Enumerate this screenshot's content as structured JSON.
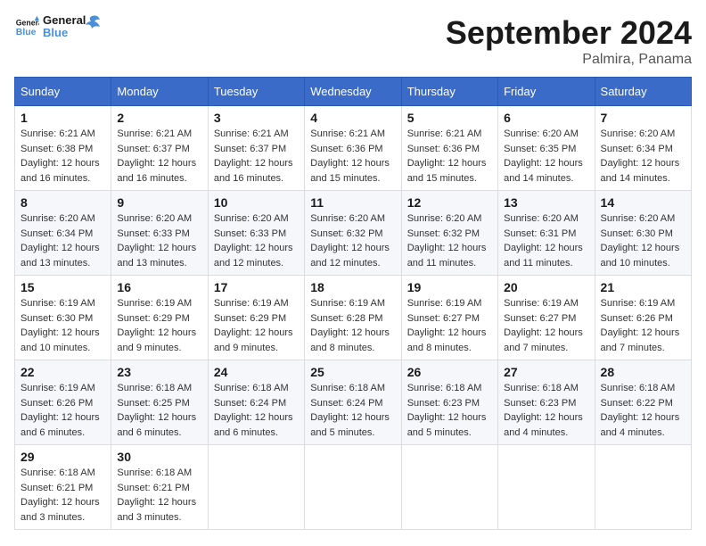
{
  "header": {
    "logo_general": "General",
    "logo_blue": "Blue",
    "month_title": "September 2024",
    "location": "Palmira, Panama"
  },
  "weekdays": [
    "Sunday",
    "Monday",
    "Tuesday",
    "Wednesday",
    "Thursday",
    "Friday",
    "Saturday"
  ],
  "weeks": [
    [
      {
        "num": "1",
        "sunrise": "6:21 AM",
        "sunset": "6:38 PM",
        "daylight": "12 hours and 16 minutes."
      },
      {
        "num": "2",
        "sunrise": "6:21 AM",
        "sunset": "6:37 PM",
        "daylight": "12 hours and 16 minutes."
      },
      {
        "num": "3",
        "sunrise": "6:21 AM",
        "sunset": "6:37 PM",
        "daylight": "12 hours and 16 minutes."
      },
      {
        "num": "4",
        "sunrise": "6:21 AM",
        "sunset": "6:36 PM",
        "daylight": "12 hours and 15 minutes."
      },
      {
        "num": "5",
        "sunrise": "6:21 AM",
        "sunset": "6:36 PM",
        "daylight": "12 hours and 15 minutes."
      },
      {
        "num": "6",
        "sunrise": "6:20 AM",
        "sunset": "6:35 PM",
        "daylight": "12 hours and 14 minutes."
      },
      {
        "num": "7",
        "sunrise": "6:20 AM",
        "sunset": "6:34 PM",
        "daylight": "12 hours and 14 minutes."
      }
    ],
    [
      {
        "num": "8",
        "sunrise": "6:20 AM",
        "sunset": "6:34 PM",
        "daylight": "12 hours and 13 minutes."
      },
      {
        "num": "9",
        "sunrise": "6:20 AM",
        "sunset": "6:33 PM",
        "daylight": "12 hours and 13 minutes."
      },
      {
        "num": "10",
        "sunrise": "6:20 AM",
        "sunset": "6:33 PM",
        "daylight": "12 hours and 12 minutes."
      },
      {
        "num": "11",
        "sunrise": "6:20 AM",
        "sunset": "6:32 PM",
        "daylight": "12 hours and 12 minutes."
      },
      {
        "num": "12",
        "sunrise": "6:20 AM",
        "sunset": "6:32 PM",
        "daylight": "12 hours and 11 minutes."
      },
      {
        "num": "13",
        "sunrise": "6:20 AM",
        "sunset": "6:31 PM",
        "daylight": "12 hours and 11 minutes."
      },
      {
        "num": "14",
        "sunrise": "6:20 AM",
        "sunset": "6:30 PM",
        "daylight": "12 hours and 10 minutes."
      }
    ],
    [
      {
        "num": "15",
        "sunrise": "6:19 AM",
        "sunset": "6:30 PM",
        "daylight": "12 hours and 10 minutes."
      },
      {
        "num": "16",
        "sunrise": "6:19 AM",
        "sunset": "6:29 PM",
        "daylight": "12 hours and 9 minutes."
      },
      {
        "num": "17",
        "sunrise": "6:19 AM",
        "sunset": "6:29 PM",
        "daylight": "12 hours and 9 minutes."
      },
      {
        "num": "18",
        "sunrise": "6:19 AM",
        "sunset": "6:28 PM",
        "daylight": "12 hours and 8 minutes."
      },
      {
        "num": "19",
        "sunrise": "6:19 AM",
        "sunset": "6:27 PM",
        "daylight": "12 hours and 8 minutes."
      },
      {
        "num": "20",
        "sunrise": "6:19 AM",
        "sunset": "6:27 PM",
        "daylight": "12 hours and 7 minutes."
      },
      {
        "num": "21",
        "sunrise": "6:19 AM",
        "sunset": "6:26 PM",
        "daylight": "12 hours and 7 minutes."
      }
    ],
    [
      {
        "num": "22",
        "sunrise": "6:19 AM",
        "sunset": "6:26 PM",
        "daylight": "12 hours and 6 minutes."
      },
      {
        "num": "23",
        "sunrise": "6:18 AM",
        "sunset": "6:25 PM",
        "daylight": "12 hours and 6 minutes."
      },
      {
        "num": "24",
        "sunrise": "6:18 AM",
        "sunset": "6:24 PM",
        "daylight": "12 hours and 6 minutes."
      },
      {
        "num": "25",
        "sunrise": "6:18 AM",
        "sunset": "6:24 PM",
        "daylight": "12 hours and 5 minutes."
      },
      {
        "num": "26",
        "sunrise": "6:18 AM",
        "sunset": "6:23 PM",
        "daylight": "12 hours and 5 minutes."
      },
      {
        "num": "27",
        "sunrise": "6:18 AM",
        "sunset": "6:23 PM",
        "daylight": "12 hours and 4 minutes."
      },
      {
        "num": "28",
        "sunrise": "6:18 AM",
        "sunset": "6:22 PM",
        "daylight": "12 hours and 4 minutes."
      }
    ],
    [
      {
        "num": "29",
        "sunrise": "6:18 AM",
        "sunset": "6:21 PM",
        "daylight": "12 hours and 3 minutes."
      },
      {
        "num": "30",
        "sunrise": "6:18 AM",
        "sunset": "6:21 PM",
        "daylight": "12 hours and 3 minutes."
      },
      null,
      null,
      null,
      null,
      null
    ]
  ]
}
